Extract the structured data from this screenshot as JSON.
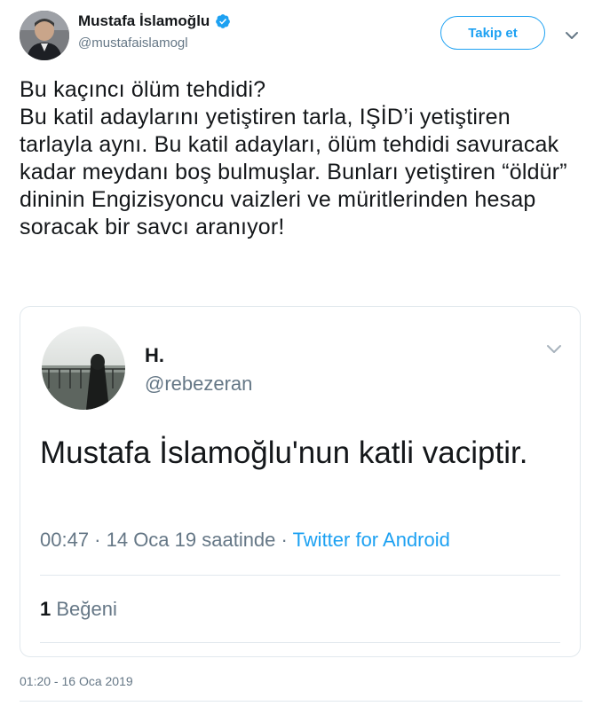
{
  "author": {
    "name": "Mustafa İslamoğlu",
    "handle": "@mustafaislamogl",
    "verified": true
  },
  "follow_button": {
    "label": "Takip et"
  },
  "tweet": {
    "lines": [
      "Bu kaçıncı ölüm tehdidi?",
      "Bu katil adaylarını yetiştiren tarla, IŞİD’i yetiştiren tarlayla aynı. Bu katil adayları, ölüm tehdidi savuracak kadar meydanı boş bulmuşlar. Bunları yetiştiren “öldür” dininin Engizisyoncu vaizleri ve müritlerinden hesap soracak bir savcı aranıyor!"
    ],
    "timestamp": "01:20 - 16 Oca 2019"
  },
  "quoted_screenshot": {
    "name": "H.",
    "handle": "@rebezeran",
    "text": "Mustafa İslamoğlu'nun katli vaciptir.",
    "meta_time": "00:47 · 14 Oca 19 saatinde · ",
    "meta_app": "Twitter for Android",
    "likes_count": "1",
    "likes_label": "Beğeni"
  },
  "icons": {
    "verified": "verified-badge-icon",
    "caret": "chevron-down-icon"
  },
  "colors": {
    "accent": "#1da1f2",
    "text": "#14171a",
    "muted": "#657786",
    "border": "#e1e8ed"
  }
}
